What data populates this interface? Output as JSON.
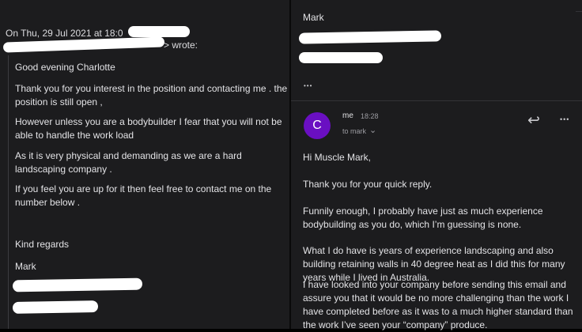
{
  "left": {
    "header_date": "On Thu, 29 Jul 2021 at 18:0",
    "header_wrote": "> wrote:",
    "paragraphs": [
      "Good evening Charlotte",
      "Thank you for you interest in the position and contacting me . the position is still open ,",
      "However unless you are a bodybuilder I fear that you will not be able to handle the work load",
      "As it is very physical and demanding as we are a hard landscaping company .",
      "If you feel you are up for it then feel free to contact me on the number below .",
      "Kind regards",
      "Mark"
    ]
  },
  "right": {
    "prev_sender": "Mark",
    "ellipsis": "•••",
    "email": {
      "avatar_letter": "C",
      "sender": "me",
      "time": "18:28",
      "to": "to mark",
      "chevron": "⌄",
      "paragraphs": [
        "Hi Muscle Mark,",
        "Thank you for your quick reply.",
        "Funnily enough, I probably have just as much experience bodybuilding as you do, which I’m guessing is none.",
        "What I do have is years of experience landscaping and also building retaining walls in 40 degree heat as I did this for many years while I lived in Australia.",
        "I have looked into your company before sending this email and assure you that it would be no more challenging than the work I have completed before as it was to a much higher standard than the work I’ve seen your “company” produce."
      ]
    },
    "reply_icon": "↩",
    "more_icon": "•••"
  },
  "colors": {
    "background": "#1c1c1e",
    "avatar": "#6a0fc2",
    "text": "#e3e3e6"
  }
}
